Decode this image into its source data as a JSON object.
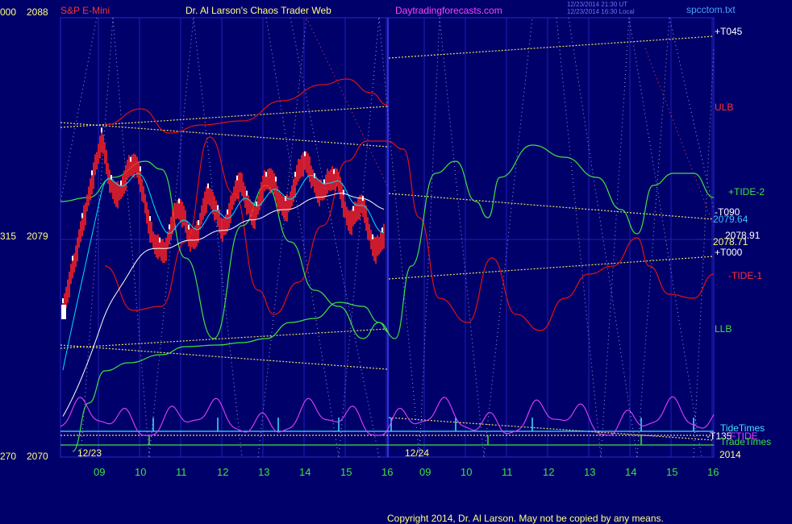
{
  "header": {
    "symbol": "S&P E-Mini",
    "title": "Dr. Al Larson's Chaos Trader Web",
    "site": "Daytradingforecasts.com",
    "stamp_line1": "12/23/2014 21:30 UT",
    "stamp_line2": "12/23/2014 16:30 Local",
    "file": "spcctom.txt"
  },
  "footer": {
    "copyright": "Copyright 2014, Dr. Al Larson. May not be copied by any means."
  },
  "y_axis": {
    "ticks": [
      {
        "left": "000",
        "right": "2088",
        "value": 2088
      },
      {
        "left": "315",
        "right": "2079",
        "value": 2079
      },
      {
        "left": "270",
        "right": "2070",
        "value": 2070
      }
    ]
  },
  "x_axis": {
    "day_labels": [
      "12/23",
      "12/24"
    ],
    "hours_day1": [
      "09",
      "10",
      "11",
      "12",
      "13",
      "14",
      "15",
      "16"
    ],
    "hours_day2": [
      "09",
      "10",
      "11",
      "12",
      "13",
      "14",
      "15",
      "16"
    ],
    "year": "2014"
  },
  "right_labels": {
    "t045": "+T045",
    "ulb": "ULB",
    "tide2": "+TIDE-2",
    "t090": "-T090",
    "p2079_64": "2079.64",
    "p2078_91": "2078.91",
    "p2078_71": "2078.71",
    "t000": "+T000",
    "tide1": "-TIDE-1",
    "llb": "LLB",
    "tidetimes": "TideTimes",
    "t135": "-T135",
    "ftide": "FTIDE",
    "tradetimes": "TradeTimes"
  },
  "colors": {
    "background": "#00006a",
    "price": "#ff2020",
    "price_high": "#ffffff",
    "ma_fast": "#00e0ff",
    "ma_slow": "#ffffff",
    "bands": "#e01010",
    "tide_green": "#40e040",
    "ftide": "#e040ff",
    "trend_yellow": "#e8e060",
    "grid": "#2a2ad0"
  },
  "chart_data": {
    "type": "line",
    "title": "S&P E-Mini",
    "ylim": [
      2070,
      2088
    ],
    "x": [
      "12/23 08:30",
      "12/23 09:00",
      "12/23 09:30",
      "12/23 10:00",
      "12/23 10:30",
      "12/23 11:00",
      "12/23 11:30",
      "12/23 12:00",
      "12/23 12:30",
      "12/23 13:00",
      "12/23 13:30",
      "12/23 14:00",
      "12/23 14:30",
      "12/23 15:00",
      "12/23 15:30",
      "12/23 16:00"
    ],
    "series": [
      {
        "name": "S&P E-Mini price",
        "values": [
          2071.5,
          2086.4,
          2083.2,
          2081.0,
          2079.0,
          2081.5,
          2080.4,
          2081.0,
          2082.5,
          2082.0,
          2081.3,
          2083.6,
          2083.2,
          2080.2,
          2078.5,
          2079.2
        ]
      },
      {
        "name": "FTIDE",
        "values": [
          null,
          null,
          null,
          null,
          null,
          null,
          null,
          null,
          null,
          null,
          null,
          null,
          null,
          null,
          null,
          null
        ]
      }
    ],
    "price_labels": [
      2079.64,
      2078.91,
      2078.71
    ],
    "grid": true
  }
}
